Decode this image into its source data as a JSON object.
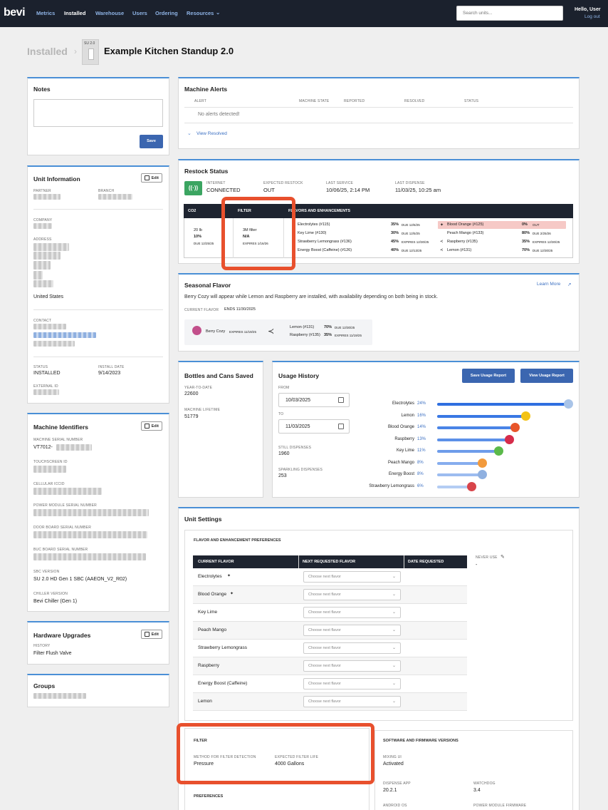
{
  "nav": {
    "logo": "bevi",
    "links": [
      "Metrics",
      "Installed",
      "Warehouse",
      "Users",
      "Ordering",
      "Resources"
    ],
    "search_placeholder": "Search units...",
    "greeting": "Hello, User",
    "logout": "Log out"
  },
  "breadcrumb": {
    "parent": "Installed",
    "badge": "SU 2.0",
    "title": "Example Kitchen Standup 2.0"
  },
  "notes": {
    "title": "Notes",
    "save": "Save"
  },
  "unit_info": {
    "title": "Unit Information",
    "edit": "Edit",
    "partner_label": "PARTNER",
    "branch_label": "BRANCH",
    "company_label": "COMPANY",
    "address_label": "ADDRESS",
    "country": "United States",
    "contact_label": "CONTACT",
    "status_label": "STATUS",
    "status": "INSTALLED",
    "install_label": "INSTALL DATE",
    "install_date": "9/14/2023",
    "external_label": "EXTERNAL ID"
  },
  "identifiers": {
    "title": "Machine Identifiers",
    "edit": "Edit",
    "serial_label": "MACHINE SERIAL NUMBER",
    "serial": "VT7012-",
    "touch_label": "TOUCHSCREEN ID",
    "iccid_label": "CELLULAR ICCID",
    "power_label": "POWER MODULE SERIAL NUMBER",
    "door_label": "DOOR BOARD SERIAL NUMBER",
    "buc_label": "BUC BOARD SERIAL NUMBER",
    "sbc_label": "SBC VERSION",
    "sbc": "SU 2.0 HD Gen 1 SBC (AAEON_V2_R02)",
    "chiller_label": "CHILLER VERSION",
    "chiller": "Bevi Chiller (Gen 1)"
  },
  "hardware": {
    "title": "Hardware Upgrades",
    "edit": "Edit",
    "history_label": "HISTORY",
    "history": "Filter Flush Valve"
  },
  "groups": {
    "title": "Groups"
  },
  "alerts": {
    "title": "Machine Alerts",
    "columns": [
      "ALERT",
      "MACHINE STATE",
      "REPORTED",
      "RESOLVED",
      "STATUS"
    ],
    "empty": "No alerts detected!",
    "view_resolved": "View Resolved"
  },
  "restock": {
    "title": "Restock Status",
    "internet_label": "INTERNET",
    "internet": "CONNECTED",
    "expected_label": "EXPECTED RESTOCK",
    "expected": "OUT",
    "last_service_label": "LAST SERVICE",
    "last_service": "10/06/25, 2:14 PM",
    "last_dispense_label": "LAST DISPENSE",
    "last_dispense": "11/03/25, 10:25 am",
    "headers": {
      "co2": "CO2",
      "filter": "FILTER",
      "flavors": "FLAVORS AND ENHANCEMENTS"
    },
    "co2": {
      "size": "20 lb",
      "pct": "10%",
      "due": "DUE 12/25/25"
    },
    "filter": {
      "name": "3M filter",
      "value": "N/A",
      "expires": "EXPIRES 1/16/26"
    },
    "flavors_left": [
      {
        "name": "Electrolytes (#115)",
        "pct": "35%",
        "note": "DUE 12/6/25"
      },
      {
        "name": "Key Lime (#130)",
        "pct": "30%",
        "note": "DUE 12/5/25"
      },
      {
        "name": "Strawberry Lemongrass (#136)",
        "pct": "45%",
        "note": "EXPIRES 12/30/25"
      },
      {
        "name": "Energy Boost (Caffeine) (#126)",
        "pct": "40%",
        "note": "DUE 12/13/25"
      }
    ],
    "flavors_right": [
      {
        "name": "Blood Orange (#125)",
        "pct": "0%",
        "note": "OUT"
      },
      {
        "name": "Peach Mango (#133)",
        "pct": "80%",
        "note": "DUE 2/25/26"
      },
      {
        "name": "Raspberry (#135)",
        "pct": "35%",
        "note": "EXPIRES 12/30/25"
      },
      {
        "name": "Lemon (#131)",
        "pct": "70%",
        "note": "DUE 12/30/25"
      }
    ]
  },
  "seasonal": {
    "title": "Seasonal Flavor",
    "learn_more": "Learn More",
    "description": "Berry Cozy will appear while Lemon and Raspberry are installed, with availability depending on both being in stock.",
    "current_label": "CURRENT FLAVOR",
    "ends": "ENDS 11/30/2025",
    "flavor": "Berry Cozy",
    "flavor_expires": "EXPIRES 11/19/25",
    "deps": [
      {
        "name": "Lemon (#131)",
        "pct": "70%",
        "note": "DUE 12/30/25"
      },
      {
        "name": "Raspberry (#135)",
        "pct": "35%",
        "note": "EXPIRES 11/19/25"
      }
    ]
  },
  "saved": {
    "title": "Bottles and Cans Saved",
    "ytd_label": "YEAR-TO-DATE",
    "ytd": "22600",
    "lifetime_label": "MACHINE LIFETIME",
    "lifetime": "51779"
  },
  "usage": {
    "title": "Usage History",
    "save_btn": "Save Usage Report",
    "view_btn": "View Usage Report",
    "from_label": "FROM",
    "from": "10/03/2025",
    "to_label": "TO",
    "to": "11/03/2025",
    "still_label": "STILL DISPENSES",
    "still": "1960",
    "sparkling_label": "SPARKLING DISPENSES",
    "sparkling": "253",
    "bars": [
      {
        "name": "Electrolytes",
        "pct": "24%",
        "value": 24,
        "color": "#2f6fe0",
        "fruit": "#a9c4e8"
      },
      {
        "name": "Lemon",
        "pct": "16%",
        "value": 16,
        "color": "#3a78e4",
        "fruit": "#f3c316"
      },
      {
        "name": "Blood Orange",
        "pct": "14%",
        "value": 14,
        "color": "#4a84e6",
        "fruit": "#e8552a"
      },
      {
        "name": "Raspberry",
        "pct": "13%",
        "value": 13,
        "color": "#5c90e8",
        "fruit": "#d62c4a"
      },
      {
        "name": "Key Lime",
        "pct": "11%",
        "value": 11,
        "color": "#6e9cea",
        "fruit": "#5bb94a"
      },
      {
        "name": "Peach Mango",
        "pct": "8%",
        "value": 8,
        "color": "#86adee",
        "fruit": "#f29a3c"
      },
      {
        "name": "Energy Boost",
        "pct": "8%",
        "value": 8,
        "color": "#9cbcf0",
        "fruit": "#8fb0e0"
      },
      {
        "name": "Strawberry Lemongrass",
        "pct": "6%",
        "value": 6,
        "color": "#b4cdf4",
        "fruit": "#d8444a"
      }
    ]
  },
  "settings": {
    "title": "Unit Settings",
    "prefs_title": "FLAVOR AND ENHANCEMENT PREFERENCES",
    "columns": [
      "CURRENT FLAVOR",
      "NEXT REQUESTED FLAVOR",
      "DATE REQUESTED"
    ],
    "never_use_label": "NEVER USE",
    "never_use": "-",
    "placeholder": "Choose next flavor",
    "rows": [
      "Electrolytes",
      "Blood Orange",
      "Key Lime",
      "Peach Mango",
      "Strawberry Lemongrass",
      "Raspberry",
      "Energy Boost (Caffeine)",
      "Lemon"
    ],
    "filter_title": "FILTER",
    "method_label": "METHOD FOR FILTER DETECTION",
    "method": "Pressure",
    "life_label": "EXPECTED FILTER LIFE",
    "life": "4000 Gallons",
    "preferences_title": "PREFERENCES",
    "software_title": "SOFTWARE AND FIRMWARE VERSIONS",
    "mixing_label": "MIXING UI",
    "mixing": "Activated",
    "dispense_label": "DISPENSE APP",
    "dispense": "20.2.1",
    "watchdog_label": "WATCHDOG",
    "watchdog": "3.4",
    "android_label": "ANDROID OS",
    "pmf_label": "POWER MODULE FIRMWARE"
  }
}
